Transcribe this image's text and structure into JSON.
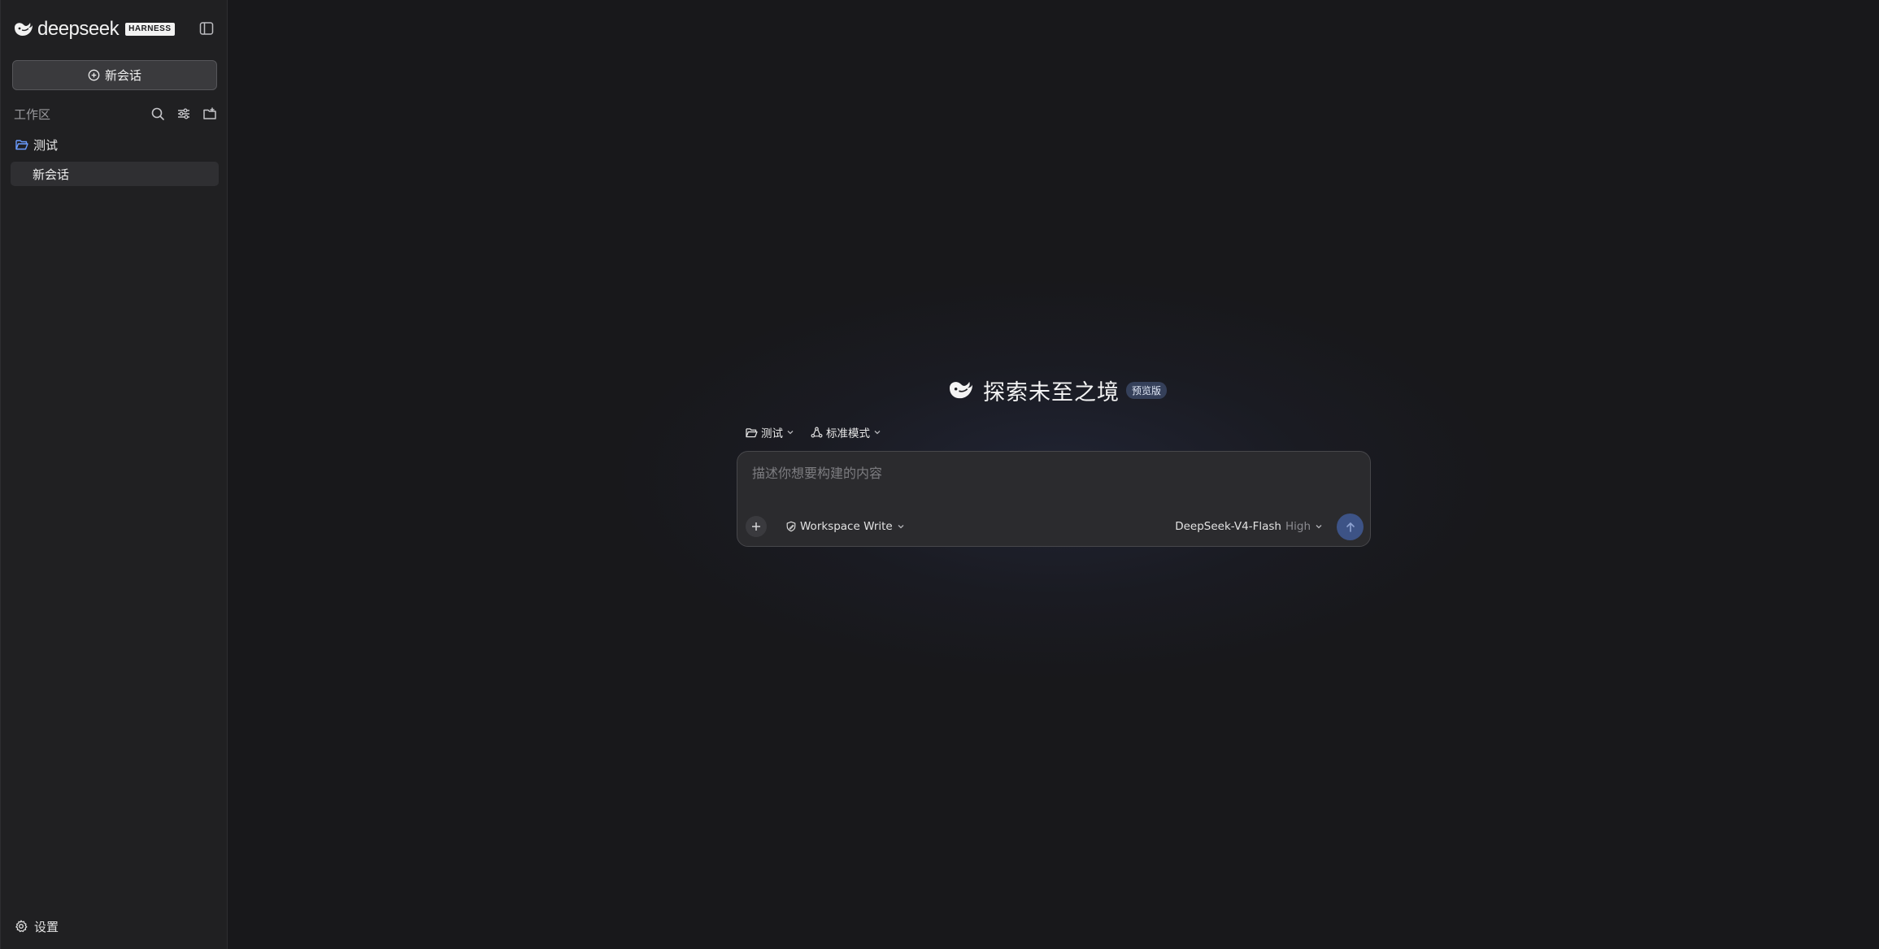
{
  "sidebar": {
    "brand_name": "deepseek",
    "brand_badge": "HARNESS",
    "new_chat_label": "新会话",
    "workspace_label": "工作区",
    "folder_name": "测试",
    "conversations": [
      {
        "label": "新会话",
        "active": true
      }
    ],
    "settings_label": "设置"
  },
  "main": {
    "hero_title": "探索未至之境",
    "hero_badge": "预览版",
    "project_selector": "测试",
    "mode_selector": "标准模式",
    "composer": {
      "placeholder": "描述你想要构建的内容",
      "permission_label": "Workspace Write",
      "model_name": "DeepSeek-V4-Flash",
      "model_level": "High"
    }
  },
  "colors": {
    "background": "#18181b",
    "sidebar_bg": "#202022",
    "accent_send": "#3d5386",
    "folder_icon": "#6b9cff",
    "badge_bg": "#35405a"
  },
  "icons": {
    "brand": "whale-logo-icon",
    "toggle": "sidebar-toggle-icon",
    "new_chat": "plus-circle-icon",
    "search": "search-icon",
    "filter": "sliders-icon",
    "new_folder": "folder-plus-icon",
    "folder": "folder-open-icon",
    "settings": "gear-icon",
    "attach": "plus-icon",
    "permission": "shield-edit-icon",
    "mode": "cycle-icon",
    "chevron": "chevron-down-icon",
    "send": "arrow-up-icon"
  }
}
